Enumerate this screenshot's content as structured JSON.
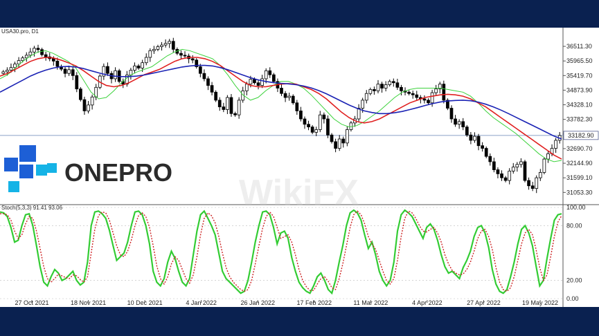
{
  "symbol_title": "USA30.pro, D1",
  "stoch_title": "Stoch(5,3,3) 91.41 93.06",
  "logo": {
    "text": "ONEPRO"
  },
  "watermark": "WikiFX",
  "current_price_label": "33182.90",
  "colors": {
    "band": "#0a2150",
    "ma_fast": "#3cd23c",
    "ma_mid": "#e02020",
    "ma_slow": "#1a22b4",
    "stoch_main": "#33cc33",
    "stoch_signal": "#cc2222",
    "price_line": "#8aa0c8",
    "logo_blue": "#1d5fd6",
    "logo_cyan": "#15b3e6",
    "logo_text": "#2b2b2b"
  },
  "chart_data": [
    {
      "type": "candlestick",
      "title": "USA30.pro, D1",
      "x_ticks": [
        "27 Oct 2021",
        "18 Nov 2021",
        "10 Dec 2021",
        "4 Jan 2022",
        "26 Jan 2022",
        "17 Feb 2022",
        "11 Mar 2022",
        "4 Apr 2022",
        "27 Apr 2022",
        "19 May 2022"
      ],
      "y_ticks": [
        36511.3,
        35965.5,
        35419.7,
        34873.9,
        34328.1,
        33782.3,
        33236.5,
        32690.7,
        32144.9,
        31599.1,
        31053.3
      ],
      "ylim": [
        30700,
        36900
      ],
      "current_price": 33182.9,
      "closes": [
        35560,
        35620,
        35720,
        35850,
        35980,
        36080,
        36180,
        36300,
        36440,
        36390,
        36200,
        36120,
        36050,
        35960,
        35760,
        35660,
        35500,
        35640,
        35420,
        34920,
        34520,
        34100,
        34320,
        34620,
        34980,
        35400,
        35760,
        35500,
        35300,
        35600,
        35200,
        35100,
        35440,
        35620,
        35780,
        35700,
        35900,
        36100,
        36350,
        36400,
        36500,
        36560,
        36620,
        36700,
        36400,
        36250,
        36180,
        36150,
        36050,
        36000,
        35750,
        35500,
        35300,
        35050,
        34800,
        34500,
        34250,
        34150,
        34600,
        34000,
        33950,
        34500,
        34850,
        35100,
        35280,
        35150,
        35050,
        35300,
        35600,
        35450,
        35200,
        34950,
        34750,
        34600,
        34650,
        34400,
        34100,
        33800,
        33600,
        33500,
        33300,
        33400,
        33950,
        33800,
        33200,
        32950,
        32700,
        33050,
        32900,
        33400,
        33650,
        33800,
        34200,
        34500,
        34750,
        34900,
        34850,
        35100,
        34950,
        35080,
        35200,
        35150,
        34980,
        34850,
        34800,
        34750,
        34700,
        34600,
        34550,
        34500,
        34400,
        34780,
        34920,
        35100,
        34500,
        34200,
        33800,
        33600,
        33700,
        33500,
        33200,
        33000,
        33150,
        32800,
        32700,
        32400,
        32200,
        31900,
        31750,
        31600,
        31500,
        31850,
        32000,
        32100,
        32200,
        31500,
        31300,
        31200,
        31600,
        31800,
        32300,
        32500,
        32700,
        33000,
        33180
      ],
      "series": [
        {
          "name": "MA fast",
          "values": [
            35300,
            35450,
            35700,
            35950,
            36150,
            36300,
            36350,
            36250,
            36100,
            35950,
            35700,
            35250,
            34800,
            34550,
            34600,
            34850,
            35150,
            35400,
            35550,
            35650,
            35750,
            35950,
            36150,
            36300,
            36400,
            36350,
            36250,
            36150,
            36050,
            35800,
            35450,
            35050,
            34700,
            34500,
            34600,
            34850,
            35050,
            35200,
            35200,
            35100,
            34950,
            34700,
            34400,
            34100,
            33800,
            33600,
            33500,
            33550,
            33700,
            33900,
            34100,
            34350,
            34600,
            34800,
            34900,
            34950,
            34950,
            34950,
            34950,
            34900,
            34850,
            34800,
            34650,
            34400,
            34100,
            33850,
            33650,
            33450,
            33250,
            33000,
            32750,
            32500,
            32300,
            32200,
            32250
          ]
        },
        {
          "name": "MA mid",
          "values": [
            35400,
            35500,
            35650,
            35800,
            35950,
            36050,
            36100,
            36080,
            36000,
            35900,
            35780,
            35600,
            35400,
            35200,
            35050,
            35000,
            35050,
            35150,
            35300,
            35450,
            35550,
            35650,
            35800,
            35950,
            36050,
            36100,
            36100,
            36050,
            35950,
            35800,
            35600,
            35400,
            35200,
            35050,
            35000,
            35000,
            35050,
            35100,
            35120,
            35100,
            35000,
            34900,
            34750,
            34550,
            34300,
            34050,
            33850,
            33700,
            33650,
            33700,
            33800,
            33950,
            34100,
            34250,
            34400,
            34500,
            34600,
            34650,
            34700,
            34720,
            34700,
            34650,
            34550,
            34400,
            34250,
            34050,
            33850,
            33650,
            33450,
            33250,
            33050,
            32850,
            32650,
            32450,
            32300
          ]
        },
        {
          "name": "MA slow",
          "values": [
            34800,
            34950,
            35100,
            35250,
            35400,
            35520,
            35620,
            35700,
            35750,
            35760,
            35740,
            35680,
            35600,
            35520,
            35450,
            35400,
            35380,
            35380,
            35400,
            35440,
            35500,
            35560,
            35620,
            35680,
            35740,
            35780,
            35800,
            35800,
            35780,
            35720,
            35640,
            35540,
            35440,
            35340,
            35260,
            35200,
            35160,
            35130,
            35110,
            35080,
            35030,
            34960,
            34860,
            34740,
            34600,
            34460,
            34320,
            34200,
            34100,
            34040,
            34000,
            34000,
            34030,
            34080,
            34150,
            34220,
            34300,
            34370,
            34430,
            34470,
            34490,
            34500,
            34480,
            34430,
            34350,
            34250,
            34130,
            34000,
            33860,
            33720,
            33580,
            33440,
            33300,
            33160,
            33050
          ]
        }
      ]
    },
    {
      "type": "line",
      "title": "Stoch(5,3,3) 91.41 93.06",
      "x_ticks": [
        "27 Oct 2021",
        "18 Nov 2021",
        "10 Dec 2021",
        "4 Jan 2022",
        "26 Jan 2022",
        "17 Feb 2022",
        "11 Mar 2022",
        "4 Apr 2022",
        "27 Apr 2022",
        "19 May 2022"
      ],
      "y_ticks": [
        100.0,
        80.0,
        20.0,
        0.0
      ],
      "ylim": [
        0,
        100
      ],
      "series": [
        {
          "name": "Main",
          "values": [
            95,
            94,
            90,
            78,
            62,
            64,
            80,
            92,
            93,
            80,
            58,
            35,
            18,
            14,
            24,
            32,
            28,
            20,
            22,
            26,
            30,
            20,
            15,
            18,
            40,
            80,
            95,
            96,
            93,
            88,
            75,
            58,
            42,
            46,
            50,
            62,
            80,
            95,
            96,
            92,
            80,
            60,
            30,
            18,
            14,
            22,
            40,
            52,
            44,
            30,
            18,
            14,
            22,
            48,
            74,
            92,
            96,
            88,
            80,
            70,
            50,
            30,
            22,
            18,
            14,
            10,
            6,
            8,
            20,
            40,
            62,
            80,
            95,
            96,
            92,
            78,
            60,
            72,
            74,
            66,
            45,
            30,
            18,
            12,
            8,
            6,
            14,
            24,
            28,
            20,
            10,
            6,
            20,
            40,
            58,
            80,
            94,
            97,
            94,
            86,
            70,
            55,
            62,
            48,
            30,
            20,
            14,
            20,
            40,
            74,
            92,
            97,
            94,
            90,
            82,
            74,
            66,
            78,
            82,
            76,
            64,
            48,
            35,
            28,
            30,
            26,
            22,
            34,
            42,
            52,
            68,
            78,
            80,
            72,
            56,
            32,
            16,
            8,
            6,
            10,
            24,
            40,
            60,
            76,
            80,
            72,
            58,
            36,
            14,
            20,
            44,
            66,
            86,
            92,
            93
          ]
        },
        {
          "name": "Signal",
          "values": [
            93,
            93,
            92,
            86,
            74,
            66,
            70,
            82,
            90,
            88,
            74,
            55,
            35,
            22,
            18,
            22,
            27,
            25,
            23,
            22,
            26,
            25,
            21,
            18,
            24,
            50,
            76,
            91,
            95,
            94,
            86,
            72,
            58,
            48,
            46,
            52,
            64,
            80,
            91,
            94,
            90,
            78,
            58,
            36,
            22,
            16,
            24,
            38,
            46,
            42,
            32,
            22,
            17,
            26,
            46,
            70,
            88,
            94,
            91,
            83,
            68,
            50,
            34,
            24,
            18,
            14,
            10,
            8,
            10,
            20,
            38,
            58,
            77,
            90,
            95,
            90,
            78,
            66,
            68,
            70,
            62,
            48,
            32,
            20,
            13,
            9,
            9,
            16,
            22,
            24,
            19,
            12,
            10,
            22,
            38,
            58,
            78,
            92,
            96,
            92,
            82,
            68,
            60,
            54,
            42,
            30,
            20,
            16,
            22,
            42,
            68,
            88,
            96,
            94,
            88,
            80,
            74,
            73,
            76,
            78,
            72,
            62,
            48,
            38,
            31,
            28,
            26,
            27,
            32,
            40,
            52,
            66,
            74,
            76,
            68,
            54,
            34,
            18,
            10,
            8,
            12,
            24,
            42,
            60,
            72,
            76,
            70,
            54,
            34,
            20,
            26,
            46,
            68,
            84,
            91
          ]
        }
      ]
    }
  ]
}
